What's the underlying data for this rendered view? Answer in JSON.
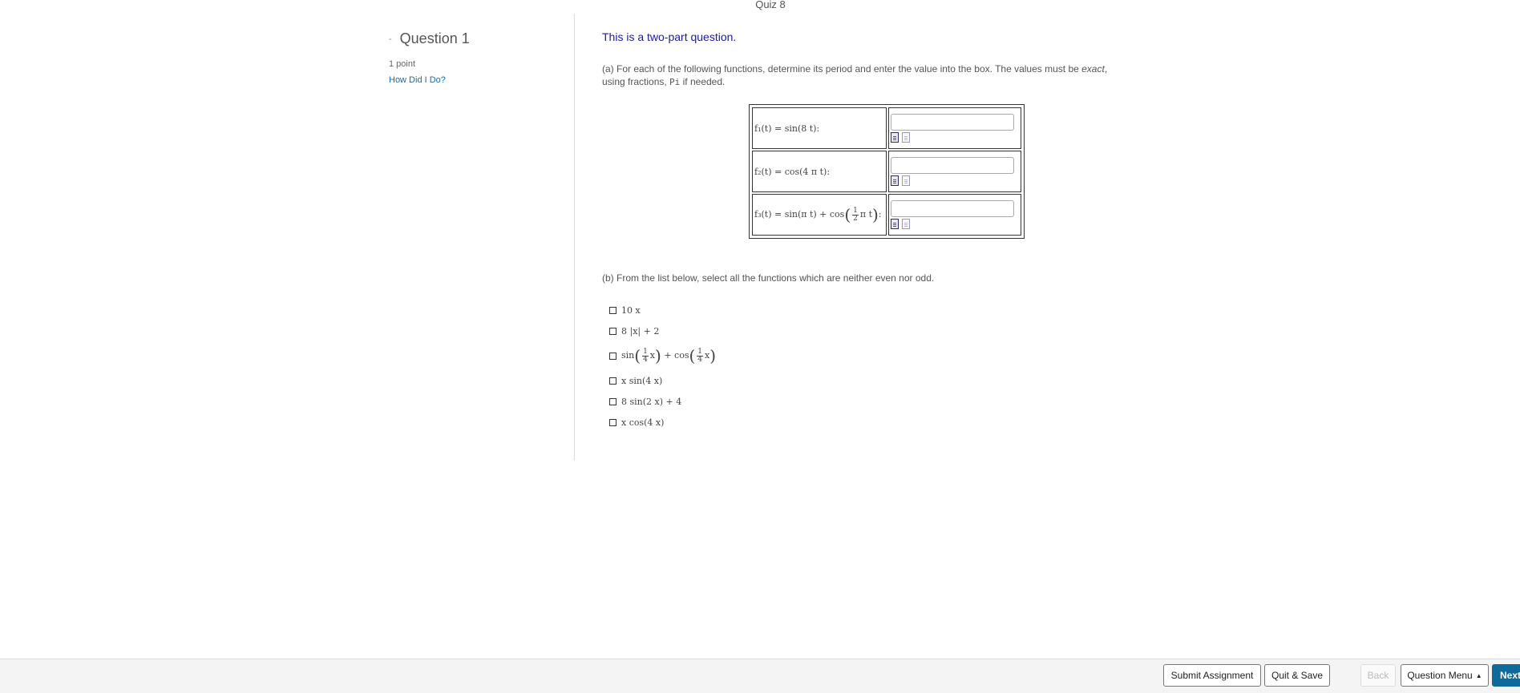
{
  "page": {
    "title": "Quiz 8"
  },
  "question": {
    "collapse_symbol": "-",
    "title": "Question 1",
    "points": "1 point",
    "how_did_i_do": "How Did I Do?"
  },
  "main": {
    "intro": "This is a two-part question.",
    "part_a": {
      "text1": "(a)  For each of the following functions, determine its period and enter the value into the box. The values must be ",
      "emph": "exact",
      "text2": ", using fractions, ",
      "pi": "Pi",
      "text3": " if needed."
    },
    "table": [
      {
        "label": "f₁(t) = sin(8 t):"
      },
      {
        "label": "f₂(t) = cos(4 π t):"
      },
      {
        "label_a": "f₃(t) = sin(π t) + cos",
        "frac_num": "1",
        "frac_den": "2",
        "label_b": "π t",
        "colon": ":"
      }
    ],
    "part_b": {
      "text": "(b) From the list below, select all the functions which are neither even nor odd.",
      "choices": [
        {
          "text": "10 x"
        },
        {
          "text": "8 |x| + 2"
        },
        {
          "a": "sin",
          "num1": "1",
          "den1": "4",
          "x1": "x",
          "plus": "+ cos",
          "num2": "1",
          "den2": "4",
          "x2": "x"
        },
        {
          "text": "x sin(4 x)"
        },
        {
          "text": "8 sin(2 x) + 4"
        },
        {
          "text": "x cos(4 x)"
        }
      ]
    }
  },
  "footer": {
    "submit": "Submit Assignment",
    "quit": "Quit & Save",
    "back": "Back",
    "menu": "Question Menu",
    "menu_caret": "▲",
    "next": "Next"
  }
}
